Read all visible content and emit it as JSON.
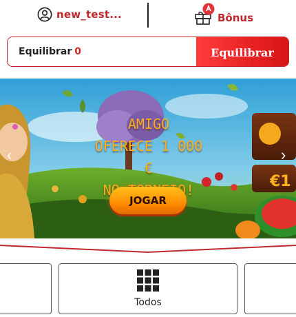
{
  "header": {
    "username": "new_test...",
    "bonus_label": "Bônus",
    "bonus_badge_icon": "coin-icon"
  },
  "balance": {
    "label": "Equilibrar",
    "value": "0",
    "button_label": "Equilibrar"
  },
  "banner": {
    "line1": "AMIGO",
    "line2": "OFERECE 1 000 €",
    "line3": "NO TORNEIO!",
    "play_label": "JOGAR",
    "side_sign_text": "€1"
  },
  "categories": {
    "items": [
      {
        "label": "",
        "icon": "category-icon"
      },
      {
        "label": "Todos",
        "icon": "grid-icon"
      },
      {
        "label": "",
        "icon": "category-icon"
      }
    ]
  },
  "colors": {
    "brand_red": "#c0282d",
    "button_red": "#e41e1e",
    "play_orange": "#ff8c00"
  }
}
